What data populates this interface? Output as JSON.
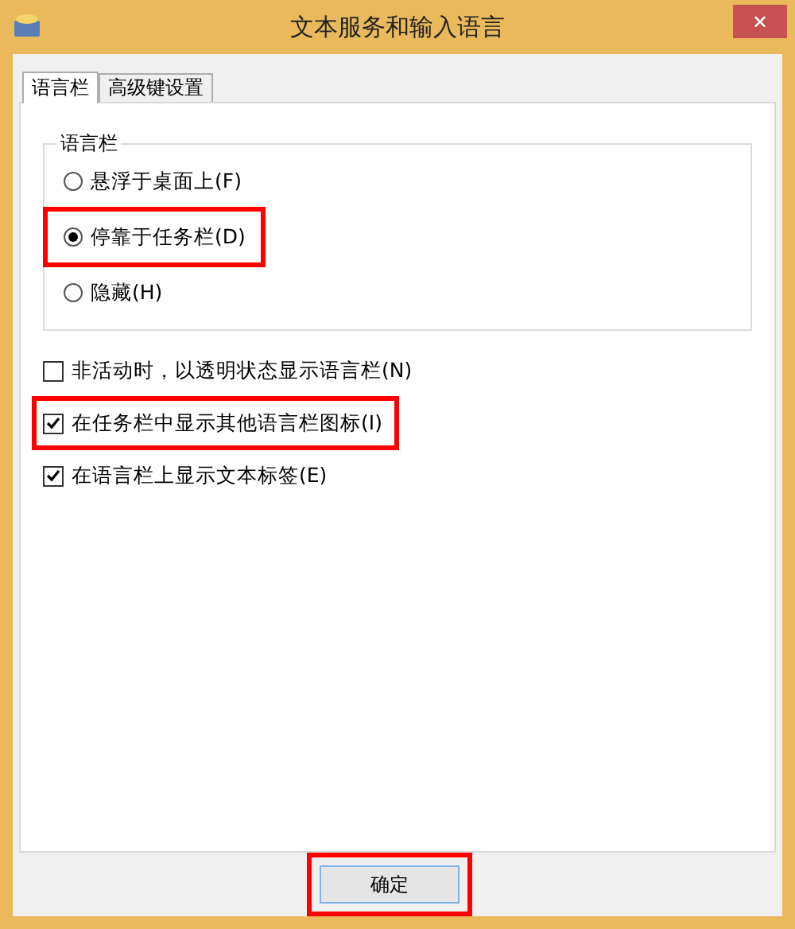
{
  "window": {
    "title": "文本服务和输入语言",
    "close": "✕"
  },
  "tabs": [
    {
      "label": "语言栏",
      "selected": true
    },
    {
      "label": "高级键设置",
      "selected": false
    }
  ],
  "language_bar_group": {
    "title": "语言栏",
    "options": [
      {
        "label": "悬浮于桌面上(F)",
        "selected": false,
        "highlighted": false
      },
      {
        "label": "停靠于任务栏(D)",
        "selected": true,
        "highlighted": true
      },
      {
        "label": "隐藏(H)",
        "selected": false,
        "highlighted": false
      }
    ]
  },
  "checkboxes": [
    {
      "label": "非活动时，以透明状态显示语言栏(N)",
      "checked": false,
      "highlighted": false
    },
    {
      "label": "在任务栏中显示其他语言栏图标(I)",
      "checked": true,
      "highlighted": true
    },
    {
      "label": "在语言栏上显示文本标签(E)",
      "checked": true,
      "highlighted": false
    }
  ],
  "buttons": [
    {
      "label": "确定",
      "highlighted": true
    }
  ]
}
